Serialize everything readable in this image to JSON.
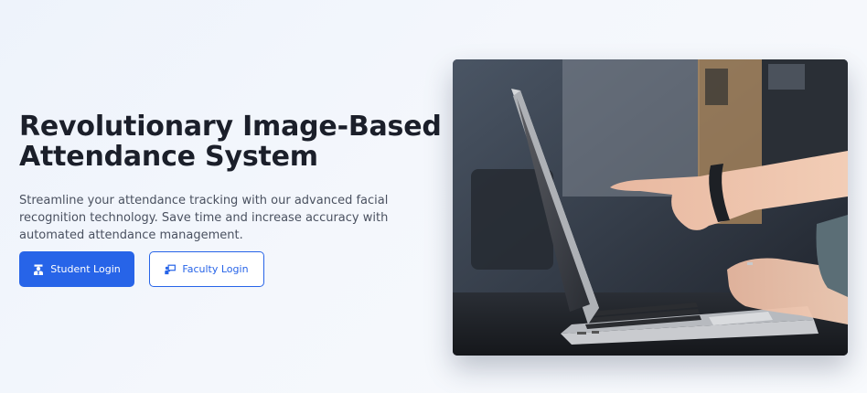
{
  "hero": {
    "title_line1": "Revolutionary Image-Based",
    "title_line2": "Attendance System",
    "subtitle": "Streamline your attendance tracking with our advanced facial recognition technology. Save time and increase accuracy with automated attendance management.",
    "student_login_label": "Student Login",
    "faculty_login_label": "Faculty Login",
    "student_icon": "user-graduate-icon",
    "faculty_icon": "chalkboard-teacher-icon"
  },
  "colors": {
    "primary": "#2764e8",
    "heading": "#1b1f2a",
    "body_text": "#4a5160",
    "background": "#f1f5fb"
  }
}
